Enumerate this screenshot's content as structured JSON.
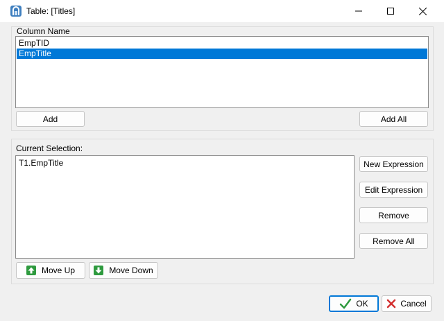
{
  "window": {
    "title": "Table: [Titles]",
    "app_icon": "database-table-icon",
    "minimize_icon": "minimize-icon",
    "maximize_icon": "maximize-icon",
    "close_icon": "close-icon"
  },
  "column_name": {
    "label": "Column Name",
    "items": [
      {
        "label": "EmpTID",
        "selected": false
      },
      {
        "label": "EmpTitle",
        "selected": true
      }
    ],
    "add_label": "Add",
    "add_all_label": "Add All"
  },
  "current_selection": {
    "label": "Current Selection:",
    "items": [
      "T1.EmpTitle"
    ],
    "new_expression_label": "New Expression",
    "edit_expression_label": "Edit Expression",
    "remove_label": "Remove",
    "remove_all_label": "Remove All",
    "move_up_label": "Move Up",
    "move_down_label": "Move Down"
  },
  "footer": {
    "ok_label": "OK",
    "cancel_label": "Cancel"
  },
  "colors": {
    "selection": "#0078d7",
    "arrow_green": "#2e9a3e",
    "ok_check": "#2e9a3e",
    "cancel_x": "#d32f2f"
  }
}
